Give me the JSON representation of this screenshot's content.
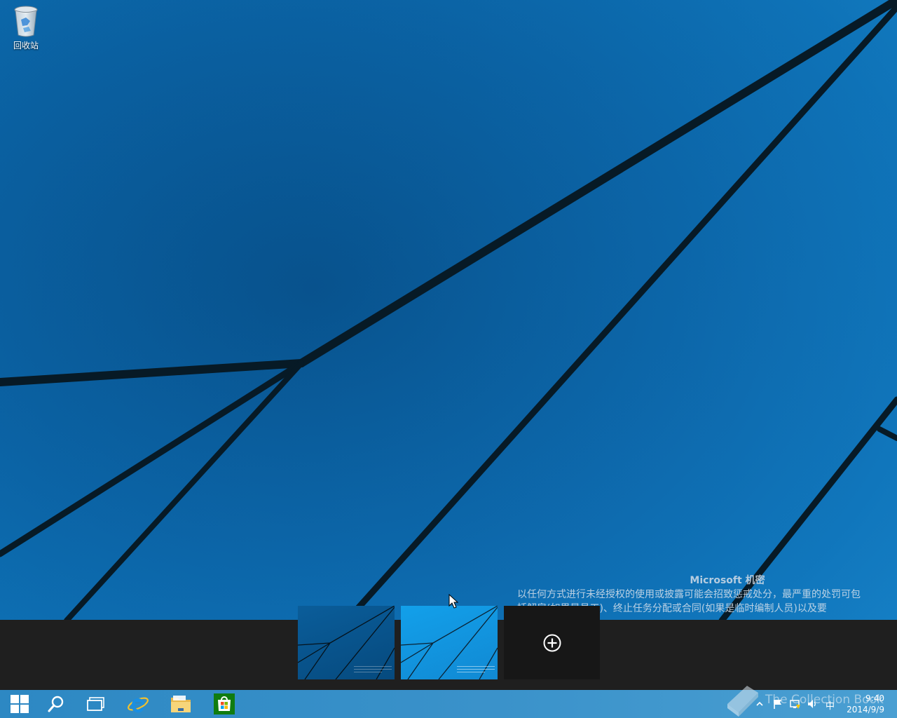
{
  "desktop": {
    "icons": [
      {
        "label": "回收站",
        "icon": "recycle-bin-icon"
      }
    ]
  },
  "confidential_notice": {
    "title": "Microsoft 机密",
    "line1": "以任何方式进行未经授权的使用或披露可能会招致惩戒处分，最严重的处罚可包",
    "line2": "括解雇(如果是员工)、终止任务分配或合同(如果是临时编制人员)以及要"
  },
  "task_view": {
    "desktops": [
      {
        "name": "desktop-1",
        "active": false
      },
      {
        "name": "desktop-2",
        "active": true
      }
    ],
    "add_desktop_icon": "plus-circle-icon"
  },
  "taskbar": {
    "buttons": [
      "windows-start-icon",
      "search-icon",
      "task-view-icon",
      "internet-explorer-icon",
      "file-explorer-icon",
      "store-icon"
    ],
    "accent": "#2d88c3"
  },
  "tray": {
    "icons": [
      "show-hidden-icons-icon",
      "action-center-flag-icon",
      "network-icon",
      "volume-icon",
      "input-method-icon"
    ],
    "ime_label": "中",
    "time": "9:40",
    "date": "2014/9/9"
  },
  "watermark": {
    "text": "The Collection Book"
  }
}
